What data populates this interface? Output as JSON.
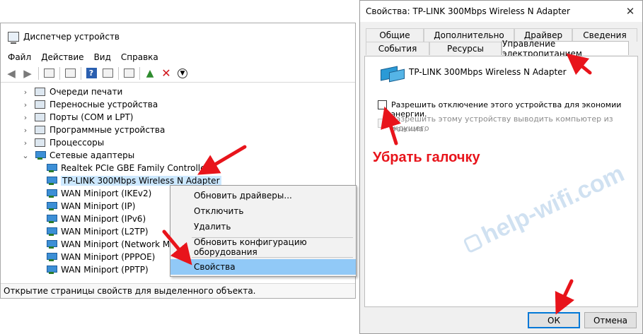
{
  "device_manager": {
    "title": "Диспетчер устройств",
    "menu": [
      "Файл",
      "Действие",
      "Вид",
      "Справка"
    ],
    "tree": [
      {
        "label": "Очереди печати",
        "kind": "category"
      },
      {
        "label": "Переносные устройства",
        "kind": "category"
      },
      {
        "label": "Порты (COM и LPT)",
        "kind": "category"
      },
      {
        "label": "Программные устройства",
        "kind": "category"
      },
      {
        "label": "Процессоры",
        "kind": "category"
      },
      {
        "label": "Сетевые адаптеры",
        "kind": "expanded"
      },
      {
        "label": "Realtek PCIe GBE Family Controller",
        "kind": "device"
      },
      {
        "label": "TP-LINK 300Mbps Wireless N Adapter",
        "kind": "device-selected"
      },
      {
        "label": "WAN Miniport (IKEv2)",
        "kind": "device"
      },
      {
        "label": "WAN Miniport (IP)",
        "kind": "device"
      },
      {
        "label": "WAN Miniport (IPv6)",
        "kind": "device"
      },
      {
        "label": "WAN Miniport (L2TP)",
        "kind": "device"
      },
      {
        "label": "WAN Miniport (Network Mon",
        "kind": "device"
      },
      {
        "label": "WAN Miniport (PPPOE)",
        "kind": "device"
      },
      {
        "label": "WAN Miniport (PPTP)",
        "kind": "device"
      }
    ],
    "status": "Открытие страницы свойств для выделенного объекта."
  },
  "context_menu": {
    "items": [
      "Обновить драйверы...",
      "Отключить",
      "Удалить",
      "Обновить конфигурацию оборудования",
      "Свойства"
    ],
    "selected": "Свойства"
  },
  "properties": {
    "title": "Свойства: TP-LINK 300Mbps Wireless N Adapter",
    "tabs_row1": [
      "Общие",
      "Дополнительно",
      "Драйвер",
      "Сведения"
    ],
    "tabs_row2": [
      "События",
      "Ресурсы",
      "Управление электропитанием"
    ],
    "active_tab": "Управление электропитанием",
    "device_name": "TP-LINK 300Mbps Wireless N Adapter",
    "option1": "Разрешить отключение этого устройства для экономии энергии.",
    "option1_checked": false,
    "option2_line1": "Разрешить этому устройству выводить компьютер из ждущего",
    "option2_line2": "режима.",
    "option2_enabled": false,
    "ok_label": "ОК",
    "cancel_label": "Отмена"
  },
  "annotation": {
    "text": "Убрать галочку",
    "color": "#e8141b"
  },
  "watermark": {
    "text": "help-wifi.com"
  },
  "colors": {
    "selection": "#cce8ff",
    "menu_highlight": "#91c9f7",
    "arrow": "#e8141b",
    "focus_border": "#0078d7"
  }
}
